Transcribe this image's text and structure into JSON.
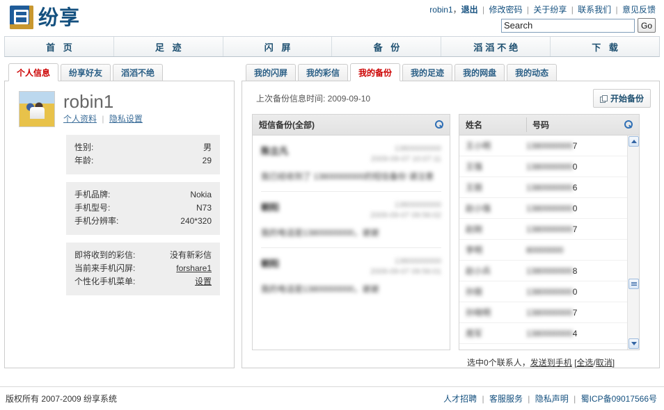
{
  "brand": {
    "name": "纷享",
    "logo_icon": "fenxiang-logo-icon"
  },
  "topbar": {
    "username": "robin1",
    "username_suffix": "，",
    "logout": "退出",
    "links": [
      "修改密码",
      "关于纷享",
      "联系我们",
      "意见反馈"
    ],
    "separator": "|"
  },
  "search": {
    "value": "Search",
    "placeholder": "Search",
    "button": "Go",
    "icon": "search-icon"
  },
  "mainnav": {
    "items": [
      "首 页",
      "足 迹",
      "闪 屏",
      "备 份",
      "滔滔不绝",
      "下 载"
    ]
  },
  "left": {
    "tabs": [
      {
        "label": "个人信息",
        "active": true
      },
      {
        "label": "纷享好友",
        "active": false
      },
      {
        "label": "滔滔不绝",
        "active": false
      }
    ],
    "profile": {
      "name": "robin1",
      "avatar_icon": "avatar",
      "links": [
        "个人资料",
        "隐私设置"
      ],
      "link_sep": "|"
    },
    "info_groups": [
      {
        "rows": [
          {
            "key": "性别:",
            "value": "男"
          },
          {
            "key": "年龄:",
            "value": "29"
          }
        ]
      },
      {
        "rows": [
          {
            "key": "手机品牌:",
            "value": "Nokia"
          },
          {
            "key": "手机型号:",
            "value": "N73"
          },
          {
            "key": "手机分辨率:",
            "value": "240*320"
          }
        ]
      },
      {
        "rows": [
          {
            "key": "即将收到的彩信:",
            "value": "没有新彩信",
            "link": false
          },
          {
            "key": "当前来手机闪屏:",
            "value": "forshare1",
            "link": true
          },
          {
            "key": "个性化手机菜单:",
            "value": "设置",
            "link": true
          }
        ]
      }
    ]
  },
  "right": {
    "tabs": [
      {
        "label": "我的闪屏",
        "active": false
      },
      {
        "label": "我的彩信",
        "active": false
      },
      {
        "label": "我的备份",
        "active": true
      },
      {
        "label": "我的足迹",
        "active": false
      },
      {
        "label": "我的网盘",
        "active": false
      },
      {
        "label": "我的动态",
        "active": false
      }
    ],
    "backup": {
      "last_time_label": "上次备份信息时间: 2009-09-10",
      "start_button": "开始备份",
      "start_button_icon": "copy-icon"
    },
    "sms_panel": {
      "title": "短信备份(全部)",
      "search_icon": "search-icon",
      "items": [
        {
          "sender_lead": "陈",
          "sender": "陈立凡",
          "number": "13800000000",
          "time": "2009-09-07 10:07:11",
          "body_lead": "我",
          "body": "我已经收到了 13800000000的短信备份 请注意"
        },
        {
          "sender_lead": "朝",
          "sender": "朝阳",
          "number": "13800000000",
          "time": "2009-09-07 09:56:02",
          "body_lead": "我",
          "body": "我的电话是13800000000，谢谢"
        },
        {
          "sender_lead": "朝",
          "sender": "朝阳",
          "number": "13800000000",
          "time": "2009-09-07 09:56:01",
          "body_lead": "我",
          "body": "我的电话是13800000000，谢谢"
        }
      ]
    },
    "contacts_panel": {
      "columns": [
        "姓名",
        "号码"
      ],
      "search_icon": "search-icon",
      "rows": [
        {
          "name": "王小明",
          "number_masked": "1380000000",
          "number_tail": "7"
        },
        {
          "name": "王强",
          "number_masked": "1380000000",
          "number_tail": "0"
        },
        {
          "name": "王丽",
          "number_masked": "1380000000",
          "number_tail": "6"
        },
        {
          "name": "赵小强",
          "number_masked": "1380000000",
          "number_tail": "0"
        },
        {
          "name": "赵刚",
          "number_masked": "1380000000",
          "number_tail": "7"
        },
        {
          "name": "李明",
          "number_masked": "80000000",
          "number_tail": ""
        },
        {
          "name": "赵小兵",
          "number_masked": "1380000000",
          "number_tail": "8"
        },
        {
          "name": "孙丽",
          "number_masked": "1380000000",
          "number_tail": "0"
        },
        {
          "name": "孙晓明",
          "number_masked": "1380000000",
          "number_tail": "7"
        },
        {
          "name": "周军",
          "number_masked": "1380000000",
          "number_tail": "4"
        }
      ],
      "footer": {
        "prefix": "选中",
        "count": "0",
        "middle": "个联系人，",
        "send_link": "发送到手机",
        "bracket_open": "[",
        "select_all": "全选",
        "slash": "/",
        "cancel": "取消",
        "bracket_close": "]"
      },
      "scrollbar": {
        "up_icon": "chevron-up-icon",
        "down_icon": "chevron-down-icon",
        "thumb_icon": "scrollbar-thumb"
      }
    }
  },
  "footer": {
    "copyright": "版权所有  2007-2009 纷享系统",
    "links": [
      "人才招聘",
      "客服服务",
      "隐私声明",
      "蜀ICP备09017566号"
    ],
    "separator": "|"
  }
}
